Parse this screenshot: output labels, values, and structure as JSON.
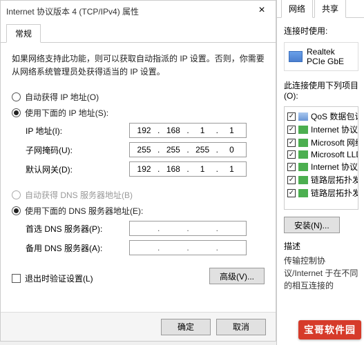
{
  "dialog": {
    "title": "Internet 协议版本 4 (TCP/IPv4) 属性",
    "tab_general": "常规",
    "description": "如果网络支持此功能，则可以获取自动指派的 IP 设置。否则，你需要从网络系统管理员处获得适当的 IP 设置。",
    "radio_ip_auto": "自动获得 IP 地址(O)",
    "radio_ip_manual": "使用下面的 IP 地址(S):",
    "ip_label": "IP 地址(I):",
    "ip_value": [
      "192",
      "168",
      "1",
      "1"
    ],
    "mask_label": "子网掩码(U):",
    "mask_value": [
      "255",
      "255",
      "255",
      "0"
    ],
    "gateway_label": "默认网关(D):",
    "gateway_value": [
      "192",
      "168",
      "1",
      "1"
    ],
    "radio_dns_auto": "自动获得 DNS 服务器地址(B)",
    "radio_dns_manual": "使用下面的 DNS 服务器地址(E):",
    "dns1_label": "首选 DNS 服务器(P):",
    "dns2_label": "备用 DNS 服务器(A):",
    "validate_label": "退出时验证设置(L)",
    "advanced_btn": "高级(V)...",
    "ok_btn": "确定",
    "cancel_btn": "取消"
  },
  "bg": {
    "tab_network": "网络",
    "tab_share": "共享",
    "connect_using": "连接时使用:",
    "adapter_name": "Realtek PCIe GbE",
    "list_label": "此连接使用下列项目(O):",
    "items": [
      "QoS 数据包计划",
      "Internet 协议版本",
      "Microsoft 网络适",
      "Microsoft LLDP",
      "Internet 协议版本",
      "链路层拓扑发现响",
      "链路层拓扑发现响"
    ],
    "install_btn": "安装(N)...",
    "desc_label": "描述",
    "desc_text": "传输控制协议/Internet 于在不同的相互连接的"
  },
  "watermark": "宝哥软件园"
}
